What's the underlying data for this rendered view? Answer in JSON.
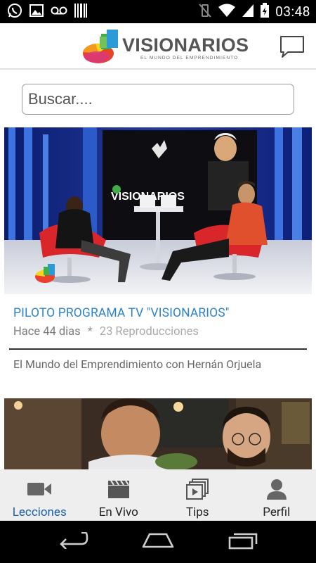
{
  "status_bar": {
    "time": "03:48",
    "left_icons": [
      "whatsapp-icon",
      "image-icon",
      "voicemail-icon",
      "barcode-icon"
    ],
    "right_icons": [
      "vibrate-off-icon",
      "wifi-icon",
      "battery-charging-icon"
    ]
  },
  "app_bar": {
    "logo_title": "VISIONARIOS",
    "logo_subtitle": "EL MUNDO DEL EMPRENDIMIENTO",
    "action_icon": "chat-bubble-icon"
  },
  "search": {
    "placeholder": "Buscar....",
    "value": ""
  },
  "feed": [
    {
      "title": "PILOTO PROGRAMA TV \"VISIONARIOS\"",
      "age": "Hace 44 dias",
      "separator": "*",
      "views": "23 Reproducciones",
      "description": "El Mundo del Emprendimiento con Hernán Orjuela"
    },
    {
      "title": "",
      "age": "",
      "views": "",
      "description": ""
    }
  ],
  "bottom_nav": [
    {
      "label": "Lecciones",
      "icon": "video-camera-icon",
      "active": true
    },
    {
      "label": "En Vivo",
      "icon": "clapperboard-icon",
      "active": false
    },
    {
      "label": "Tips",
      "icon": "photo-stack-icon",
      "active": false
    },
    {
      "label": "Perfil",
      "icon": "person-icon",
      "active": false
    }
  ],
  "system_nav": [
    "back-icon",
    "home-icon",
    "recents-icon"
  ],
  "colors": {
    "accent": "#2e83c8",
    "active_nav": "#1f5fa8",
    "nav_bg": "#eeeeee"
  }
}
